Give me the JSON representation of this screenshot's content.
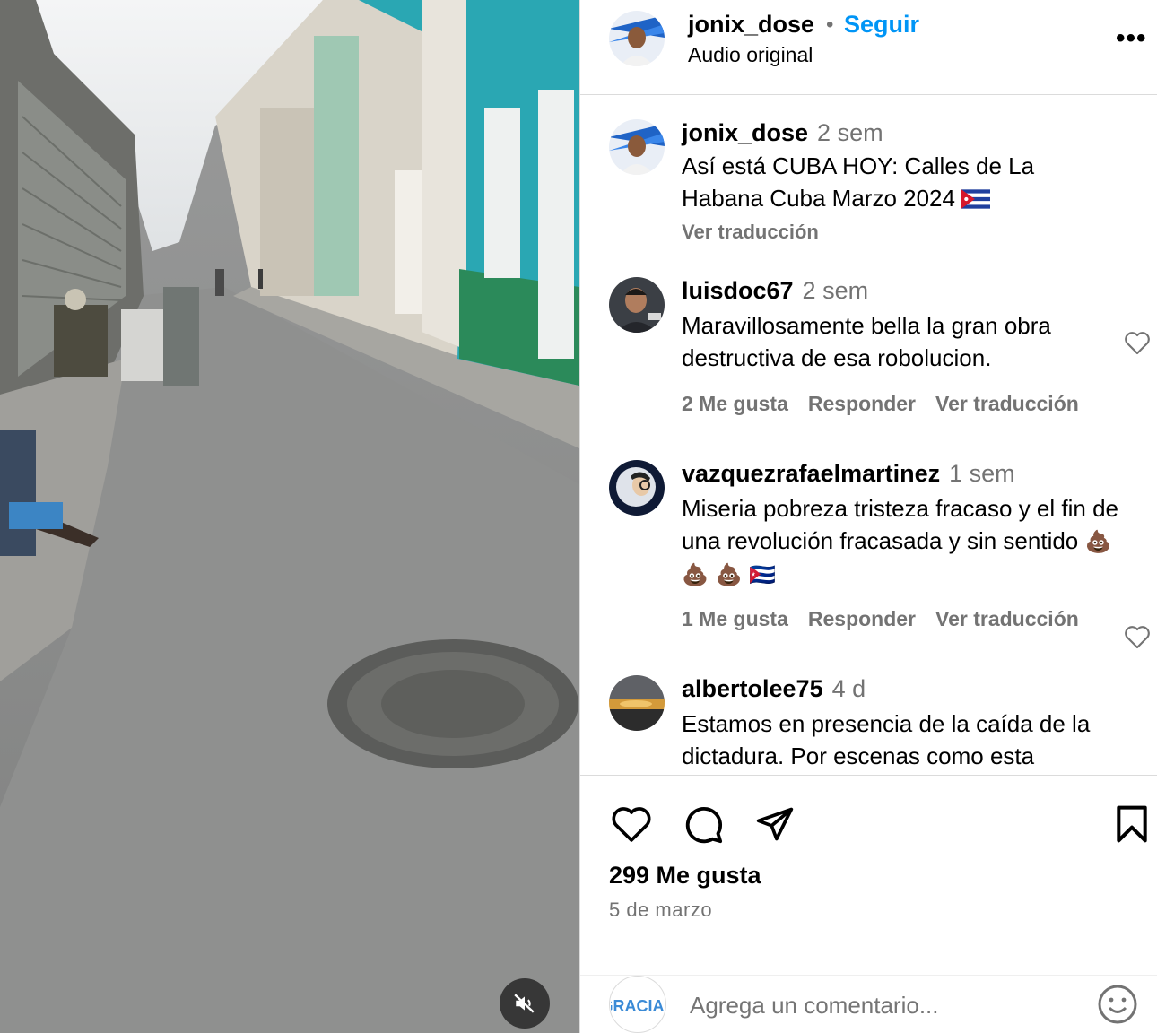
{
  "post": {
    "username": "jonix_dose",
    "separator": "•",
    "follow_label": "Seguir",
    "audio_label": "Audio original",
    "more_label": "•••"
  },
  "caption": {
    "username": "jonix_dose",
    "time": "2 sem",
    "text": "Así está CUBA HOY: Calles de La Habana Cuba Marzo 2024",
    "flag": "🇨🇺",
    "translate_label": "Ver traducción"
  },
  "comments": [
    {
      "username": "luisdoc67",
      "time": "2 sem",
      "text": "Maravillosamente bella la gran obra destructiva de esa robolucion.",
      "likes": "2 Me gusta",
      "reply": "Responder",
      "translate": "Ver traducción"
    },
    {
      "username": "vazquezrafaelmartinez",
      "time": "1 sem",
      "text": "Miseria pobreza tristeza fracaso y el fin de una revolución fracasada y sin sentido",
      "emoji_tail": "💩 💩 💩 🇨🇺",
      "likes": "1 Me gusta",
      "reply": "Responder",
      "translate": "Ver traducción"
    },
    {
      "username": "albertolee75",
      "time": "4 d",
      "text": "Estamos en presencia de la caída de la dictadura. Por escenas como esta"
    }
  ],
  "stats": {
    "likes": "299 Me gusta",
    "date": "5 de marzo"
  },
  "add_comment": {
    "placeholder": "Agrega un comentario...",
    "avatar_text": "GRACIAS"
  },
  "colors": {
    "link_blue": "#0095f6",
    "secondary_text": "#737373",
    "border": "#dbdbdb"
  },
  "icons": [
    "heart-icon",
    "comment-icon",
    "share-icon",
    "bookmark-icon",
    "mute-icon",
    "emoji-icon",
    "more-icon"
  ]
}
